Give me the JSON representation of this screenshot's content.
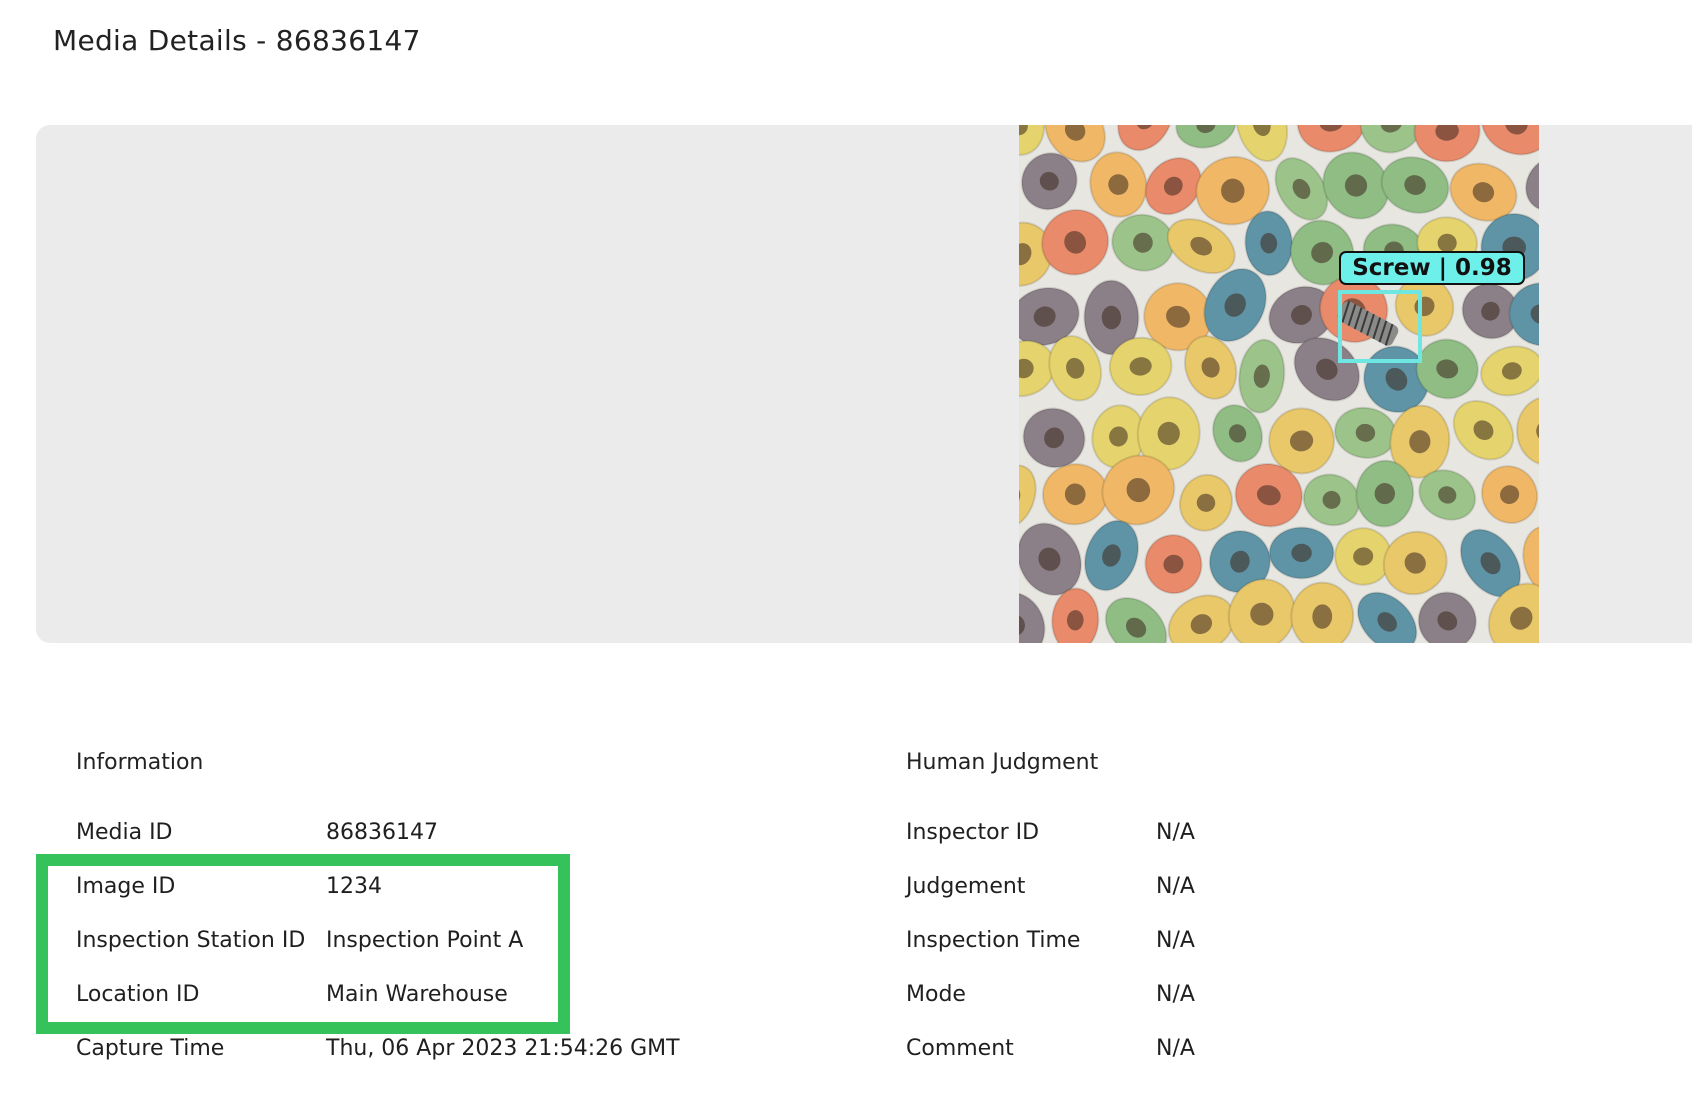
{
  "header": {
    "title": "Media Details - 86836147"
  },
  "media": {
    "detection": {
      "label": "Screw | 0.98"
    }
  },
  "info": {
    "title": "Information",
    "rows": [
      {
        "label": "Media ID",
        "value": "86836147"
      },
      {
        "label": "Image ID",
        "value": "1234"
      },
      {
        "label": "Inspection Station ID",
        "value": "Inspection Point A"
      },
      {
        "label": "Location ID",
        "value": "Main Warehouse"
      },
      {
        "label": "Capture Time",
        "value": "Thu, 06 Apr 2023 21:54:26 GMT"
      }
    ]
  },
  "judgment": {
    "title": "Human Judgment",
    "rows": [
      {
        "label": "Inspector ID",
        "value": "N/A"
      },
      {
        "label": "Judgement",
        "value": "N/A"
      },
      {
        "label": "Inspection Time",
        "value": "N/A"
      },
      {
        "label": "Mode",
        "value": "N/A"
      },
      {
        "label": "Comment",
        "value": "N/A"
      }
    ]
  },
  "colors": {
    "highlight": "#35c25a",
    "detection_box": "#6ee7e3",
    "detection_label_bg": "#6ef0ea",
    "viewer_bg": "#ebebeb"
  }
}
